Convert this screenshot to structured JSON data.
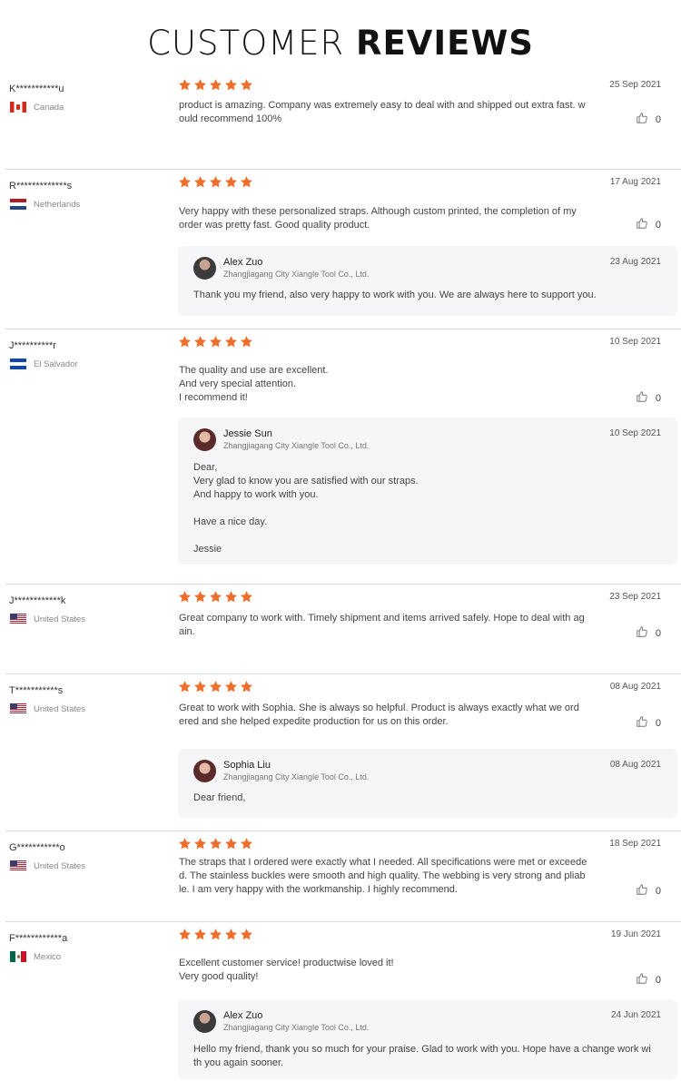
{
  "page": {
    "title_light": "CUSTOMER ",
    "title_bold": "REVIEWS"
  },
  "colors": {
    "star": "#ee6e2b",
    "divider": "#d9d9d9",
    "reply_bg": "#f6f6f8"
  },
  "reviews": [
    {
      "user": "K***********u",
      "country": "Canada",
      "flag": "flag-ca",
      "rating": 5,
      "date": "25 Sep 2021",
      "text": "product is amazing. Company was extremely easy to deal with and shipped out extra fast. w\nould recommend 100%",
      "likes": "0"
    },
    {
      "user": "R*************s",
      "country": "Netherlands",
      "flag": "flag-nl",
      "rating": 5,
      "date": "17 Aug 2021",
      "text": "Very happy with these personalized straps. Although custom printed, the completion of my\norder was pretty fast. Good quality product.",
      "likes": "0",
      "reply": {
        "name": "Alex Zuo",
        "company": "Zhangjiagang City Xiangle Tool Co., Ltd.",
        "date": "23 Aug 2021",
        "text": "Thank you my friend, also very happy to work with you. We are always here to support you."
      }
    },
    {
      "user": "J**********r",
      "country": "El Salvador",
      "flag": "flag-sv",
      "rating": 5,
      "date": "10 Sep 2021",
      "text": "The quality and use are excellent.\nAnd very special attention.\nI recommend it!",
      "likes": "0",
      "reply": {
        "name": "Jessie Sun",
        "company": "Zhangjiagang City Xiangle Tool Co., Ltd.",
        "date": "10 Sep 2021",
        "text": "Dear,\nVery glad to know you are satisfied with our straps.\nAnd happy to work with you.\n\nHave a nice day.\n\nJessie"
      }
    },
    {
      "user": "J************k",
      "country": "United States",
      "flag": "flag-us",
      "rating": 5,
      "date": "23 Sep 2021",
      "text": "Great company to work with. Timely shipment and items arrived safely. Hope to deal with ag\nain.",
      "likes": "0"
    },
    {
      "user": "T***********s",
      "country": "United States",
      "flag": "flag-us",
      "rating": 5,
      "date": "08 Aug 2021",
      "text": "Great to work with Sophia.  She is always so helpful.  Product is always exactly what we ord\nered and she helped expedite production for us on this order.",
      "likes": "0",
      "reply": {
        "name": "Sophia Liu",
        "company": "Zhangjiagang City Xiangle Tool Co., Ltd.",
        "date": "08 Aug 2021",
        "text": "Dear friend,"
      }
    },
    {
      "user": "G***********o",
      "country": "United States",
      "flag": "flag-us",
      "rating": 5,
      "date": "18 Sep 2021",
      "text": "The straps that I ordered were exactly what I needed. All specifications were met or exceede\nd. The stainless buckles were smooth and high quality. The webbing is very strong and pliab\nle. I am very happy with the workmanship. I highly recommend.",
      "likes": "0"
    },
    {
      "user": "F************a",
      "country": "Mexico",
      "flag": "flag-mx",
      "rating": 5,
      "date": "19 Jun 2021",
      "text": "Excellent customer service! productwise loved it!\nVery good quality!",
      "likes": "0",
      "reply": {
        "name": "Alex Zuo",
        "company": "Zhangjiagang City Xiangle Tool Co., Ltd.",
        "date": "24 Jun 2021",
        "text": "Hello my friend, thank you so much for your praise.  Glad to work with you.  Hope have a change work wi\nth you again sooner."
      }
    }
  ]
}
